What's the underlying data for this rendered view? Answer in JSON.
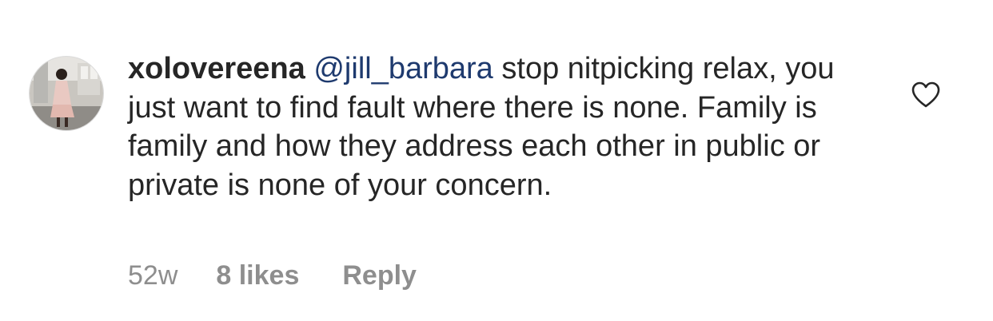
{
  "comment": {
    "username": "xolovereena",
    "mention": "@jill_barbara",
    "text": " stop nitpicking relax, you just want to find fault where there is none. Family is family and how they address each other in public or private is none of your concern.",
    "time": "52w",
    "likes": "8 likes",
    "reply_label": "Reply"
  },
  "icons": {
    "like": "heart-outline-icon",
    "avatar": "profile-photo"
  },
  "colors": {
    "text": "#262626",
    "mention": "#1e3a6e",
    "meta": "#8e8e8e"
  }
}
